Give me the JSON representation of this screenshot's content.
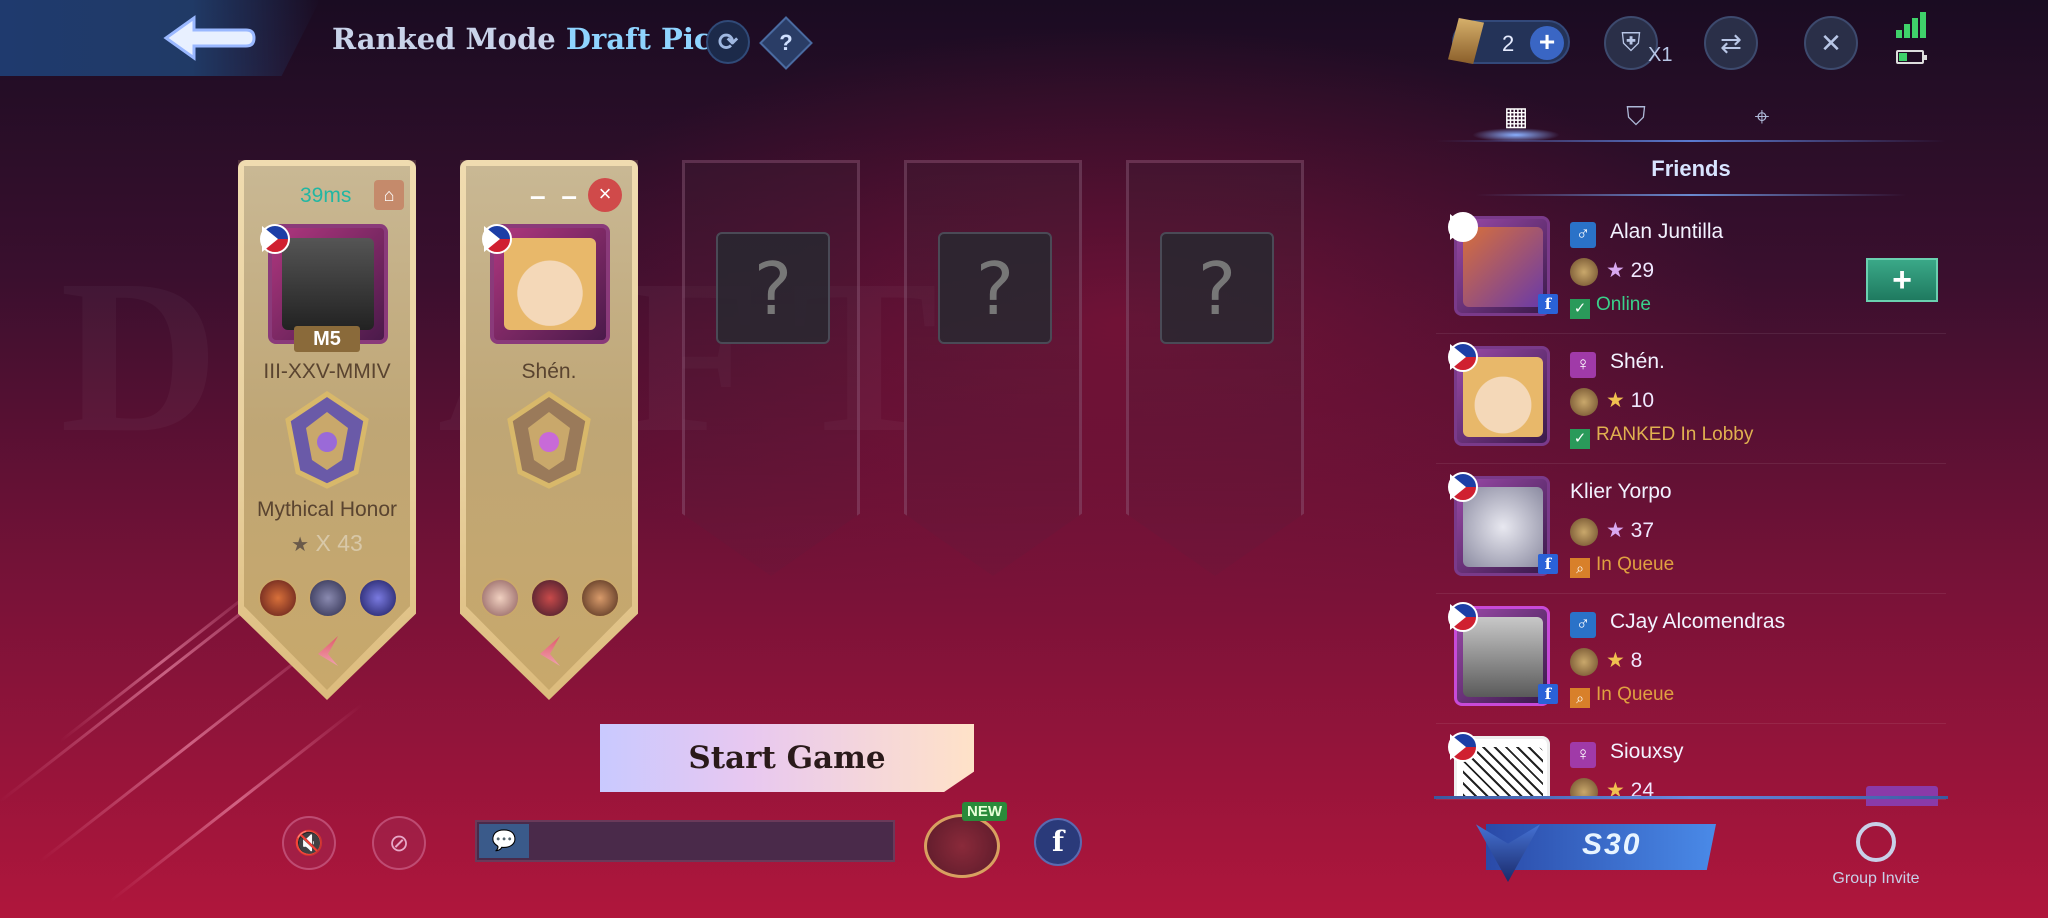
{
  "header": {
    "mode_prefix": "Ranked Mode",
    "mode_name": "Draft Pick",
    "help_icon_text": "?",
    "ticket_count": "2",
    "ticket_plus": "+",
    "multiplier": "X1"
  },
  "team": [
    {
      "ping": "39ms",
      "avatar_tag": "M5",
      "name": "III-XXV-MMIV",
      "rank": "Mythical Honor",
      "stars": "X 43"
    },
    {
      "ping": "– –",
      "close_text": "×",
      "name": "Shén."
    }
  ],
  "empty_slot_text": "?",
  "start_button": "Start Game",
  "new_badge": "NEW",
  "facebook_icon_text": "f",
  "friends_panel": {
    "title": "Friends",
    "add_button": "+",
    "friends": [
      {
        "name": "Alan Juntilla",
        "gender": "♂",
        "stars": "29",
        "status": "Online",
        "status_type": "online"
      },
      {
        "name": "Shén.",
        "gender": "♀",
        "stars": "10",
        "status": "RANKED In Lobby",
        "status_type": "lobby"
      },
      {
        "name": "Klier Yorpo",
        "gender": "",
        "stars": "37",
        "status": "In Queue",
        "status_type": "queue"
      },
      {
        "name": "CJay Alcomendras",
        "gender": "♂",
        "stars": "8",
        "status": "In Queue",
        "status_type": "queue"
      },
      {
        "name": "Siouxsy",
        "gender": "♀",
        "stars": "24",
        "status": "",
        "status_type": ""
      }
    ]
  },
  "season_label": "S30",
  "group_invite_label": "Group Invite",
  "colors": {
    "ping": "#22b6a2",
    "online": "#3ad08a",
    "queue": "#e0a040",
    "accent": "#8fd4ff"
  }
}
